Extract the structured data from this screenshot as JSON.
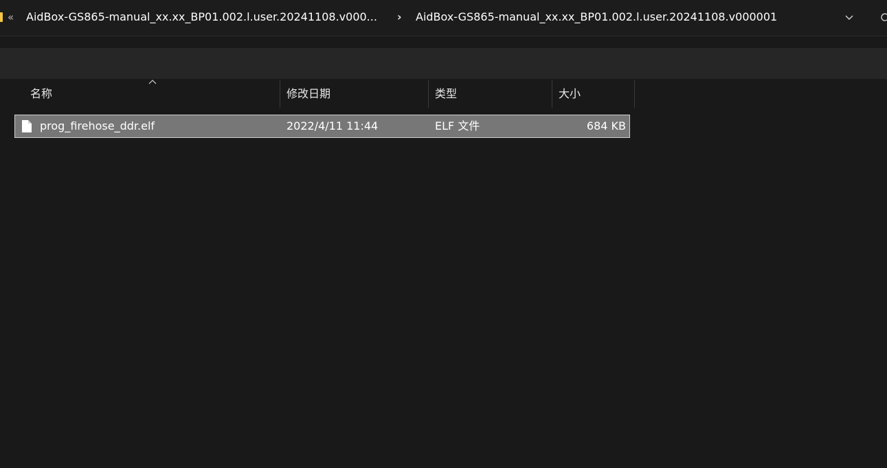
{
  "address_bar": {
    "overflow_chevron": "«",
    "breadcrumbs": [
      "AidBox-GS865-manual_xx.xx_BP01.002.l.user.20241108.v000...",
      "AidBox-GS865-manual_xx.xx_BP01.002.l.user.20241108.v000001"
    ],
    "separator": "›",
    "dropdown_icon": "chevron-down-icon",
    "refresh_icon": "refresh-icon"
  },
  "columns": {
    "name": "名称",
    "date_modified": "修改日期",
    "type": "类型",
    "size": "大小",
    "sort_icon": "chevron-up-icon"
  },
  "files": [
    {
      "name": "prog_firehose_ddr.elf",
      "date_modified": "2022/4/11 11:44",
      "type": "ELF 文件",
      "size": "684 KB",
      "icon": "file-icon",
      "selected": true
    }
  ],
  "colors": {
    "background": "#191919",
    "selection": "#777777",
    "folder_accent": "#f4c542"
  }
}
